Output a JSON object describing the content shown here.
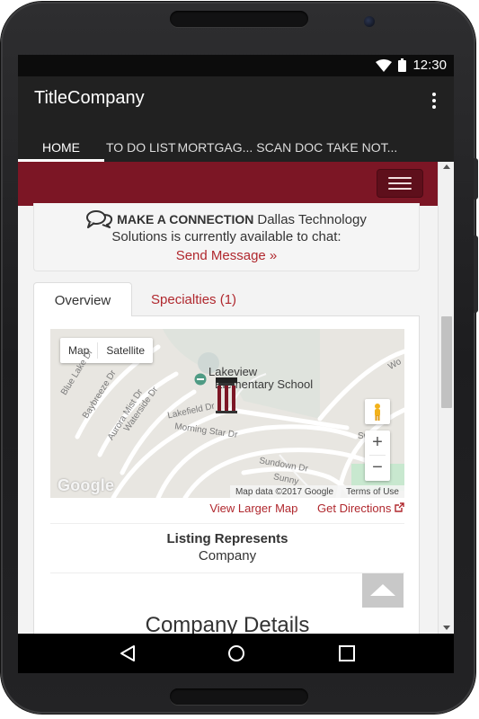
{
  "status_bar": {
    "time": "12:30"
  },
  "app": {
    "title": "TitleCompany",
    "tabs": [
      "HOME",
      "TO DO LIST",
      "MORTGAG...",
      "SCAN DOC",
      "TAKE NOT..."
    ],
    "active_tab": "HOME"
  },
  "connect": {
    "heading": "MAKE A CONNECTION",
    "text_1": "Dallas Technology",
    "text_2": "Solutions is currently available to chat:",
    "link": "Send Message »"
  },
  "content_tabs": {
    "overview": "Overview",
    "specialties": "Specialties (1)"
  },
  "map": {
    "type_map": "Map",
    "type_satellite": "Satellite",
    "place_line1": "Lakeview",
    "place_line2": "Elementary School",
    "roads": [
      "Blue Lake Dr",
      "Baybreeze Dr",
      "Aurora Mist Dr",
      "Waterside Dr",
      "Lakefield Dr",
      "Morning Star Dr",
      "Sundown Dr",
      "Sunny",
      "Wo",
      "Sw"
    ],
    "zoom_in": "+",
    "zoom_out": "−",
    "logo": "Google",
    "attribution": "Map data ©2017 Google",
    "terms": "Terms of Use"
  },
  "map_links": {
    "larger_map": "View Larger Map",
    "directions": "Get Directions"
  },
  "listing": {
    "label": "Listing Represents",
    "value": "Company"
  },
  "section_title": "Company Details",
  "colors": {
    "brand": "#7c1625",
    "link": "#b0282e",
    "app_bar": "#212121"
  },
  "icons": [
    "wifi-icon",
    "battery-icon",
    "overflow-menu-icon",
    "hamburger-icon",
    "chat-icon",
    "map-marker-icon",
    "pegman-icon",
    "external-link-icon",
    "back-to-top-icon",
    "nav-back-icon",
    "nav-home-icon",
    "nav-recents-icon"
  ]
}
